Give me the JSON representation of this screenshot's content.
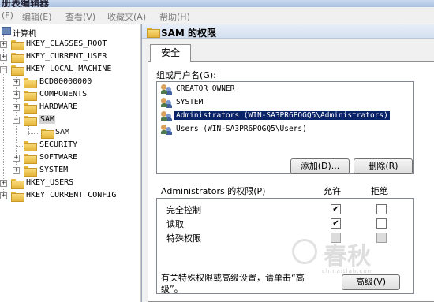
{
  "window": {
    "title": "册表编辑器"
  },
  "menu": [
    {
      "label": "(F)"
    },
    {
      "label": "编辑(E)"
    },
    {
      "label": "查看(V)"
    },
    {
      "label": "收藏夹(A)"
    },
    {
      "label": "帮助(H)"
    }
  ],
  "tree": {
    "root": "计算机",
    "nodes": [
      {
        "label": "HKEY_CLASSES_ROOT",
        "expander": "+"
      },
      {
        "label": "HKEY_CURRENT_USER",
        "expander": "+"
      },
      {
        "label": "HKEY_LOCAL_MACHINE",
        "expander": "−"
      },
      {
        "label": "BCD00000000",
        "expander": "+"
      },
      {
        "label": "COMPONENTS",
        "expander": "+"
      },
      {
        "label": "HARDWARE",
        "expander": "+"
      },
      {
        "label": "SAM",
        "expander": "−"
      },
      {
        "label": "SAM",
        "expander": ""
      },
      {
        "label": "SECURITY",
        "expander": ""
      },
      {
        "label": "SOFTWARE",
        "expander": "+"
      },
      {
        "label": "SYSTEM",
        "expander": "+"
      },
      {
        "label": "HKEY_USERS",
        "expander": "+"
      },
      {
        "label": "HKEY_CURRENT_CONFIG",
        "expander": "+"
      }
    ]
  },
  "dialog": {
    "title": "SAM 的权限",
    "tab": "安全",
    "groups_label": "组或用户名(G):",
    "users": [
      {
        "name": "CREATOR OWNER",
        "selected": false
      },
      {
        "name": "SYSTEM",
        "selected": false
      },
      {
        "name": "Administrators (WIN-SA3PR6POGQ5\\Administrators)",
        "selected": true
      },
      {
        "name": "Users (WIN-SA3PR6POGQ5\\Users)",
        "selected": false
      }
    ],
    "add_button": "添加(D)...",
    "remove_button": "删除(R)",
    "perm_header": "Administrators 的权限(P)",
    "allow_header": "允许",
    "deny_header": "拒绝",
    "permissions": [
      {
        "name": "完全控制",
        "allow": true,
        "deny": false,
        "disabled": false
      },
      {
        "name": "读取",
        "allow": true,
        "deny": false,
        "disabled": false
      },
      {
        "name": "特殊权限",
        "allow": false,
        "deny": false,
        "disabled": true
      }
    ],
    "special_note_line1": "有关特殊权限或高级设置，请单击“高",
    "special_note_line2": "级”。",
    "advanced_button": "高级(V)",
    "check_mark": "✔"
  },
  "watermark": {
    "text": "春秋",
    "sub": "chinaitlab.com"
  },
  "colors": {
    "selection": "#0a246a",
    "folder": "#e6b53a"
  }
}
